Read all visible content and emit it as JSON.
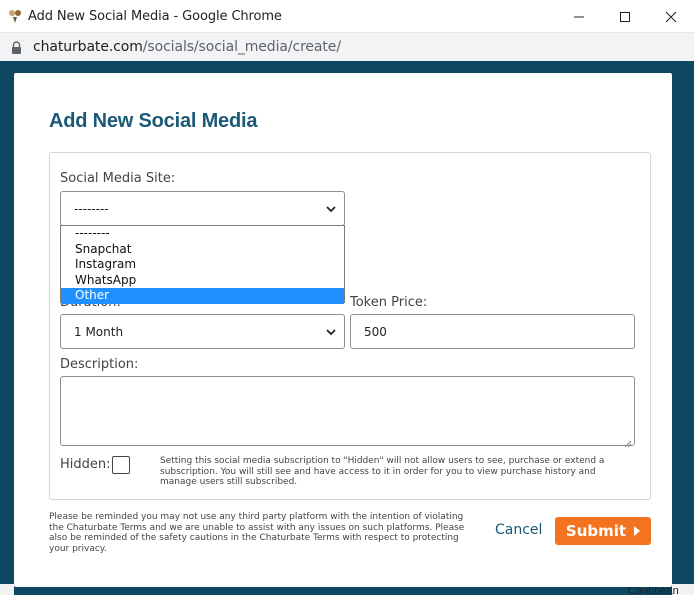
{
  "browser": {
    "window_title": "Add New Social Media - Google Chrome",
    "url_host": "chaturbate.com",
    "url_path": "/socials/social_media/create/",
    "minimize_symbol": "—",
    "maximize_symbol": "☐",
    "close_symbol": "✕"
  },
  "modal": {
    "title": "Add New Social Media"
  },
  "form": {
    "site_label": "Social Media Site:",
    "site_selected": "--------",
    "site_options": [
      {
        "label": "--------",
        "selected": false
      },
      {
        "label": "Snapchat",
        "selected": false
      },
      {
        "label": "Instagram",
        "selected": false
      },
      {
        "label": "WhatsApp",
        "selected": false
      },
      {
        "label": "Other",
        "selected": true
      }
    ],
    "duration_label": "Duration:",
    "duration_selected": "1 Month",
    "token_price_label": "Token Price:",
    "token_price_value": "500",
    "description_label": "Description:",
    "description_value": "",
    "hidden_label": "Hidden:",
    "hidden_checked": false,
    "hidden_hint": "Setting this social media subscription to \"Hidden\" will not allow users to see, purchase or extend a subscription. You will still see and have access to it in order for you to view purchase history and manage users still subscribed."
  },
  "footer": {
    "note": "Please be reminded you may not use any third party platform with the intention of violating the Chaturbate Terms and we are unable to assist with any issues on such platforms. Please also be reminded of the safety cautions in the Chaturbate Terms with respect to protecting your privacy.",
    "cancel_label": "Cancel",
    "submit_label": "Submit"
  },
  "background_peek": {
    "text": "Caribbean"
  },
  "colors": {
    "backdrop": "#0d4761",
    "title": "#1b5a76",
    "submit": "#f47321",
    "dropdown_highlight": "#1e90ff"
  }
}
